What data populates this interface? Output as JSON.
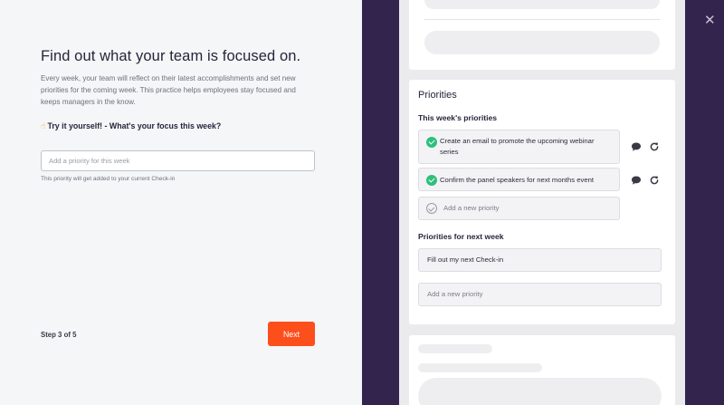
{
  "left": {
    "title": "Find out what your team is focused on.",
    "description": "Every week, your team will reflect on their latest accomplishments and set new priorities for the coming week. This practice helps employees stay focused and keeps managers in the know.",
    "tryit_icon": "☝",
    "tryit_label": "Try it yourself! - What's your focus this week?",
    "priority_input": {
      "value": "",
      "placeholder": "Add a priority for this week"
    },
    "hint": "This priority will get added to your current Check-in",
    "step": "Step 3 of 5",
    "next_label": "Next"
  },
  "close_label": "✕",
  "panel": {
    "priorities": {
      "title": "Priorities",
      "this_week_title": "This week's priorities",
      "this_week_items": [
        {
          "text": "Create an email to promote the upcoming webinar series",
          "done": true
        },
        {
          "text": "Confirm the panel speakers for next months event",
          "done": true
        }
      ],
      "add_new_this_week": "Add a new priority",
      "next_week_title": "Priorities for next week",
      "next_week_items": [
        "Fill out my next Check-in"
      ],
      "add_new_next_week": "Add a new priority"
    }
  },
  "colors": {
    "accent": "#fd4f1c",
    "sidebar": "#33244e",
    "check": "#2ebf7d"
  },
  "icons": {
    "comment": "comment-icon",
    "repeat": "refresh-icon",
    "close": "close-icon",
    "hand": "pointing-hand-icon",
    "check": "check-circle-icon"
  }
}
